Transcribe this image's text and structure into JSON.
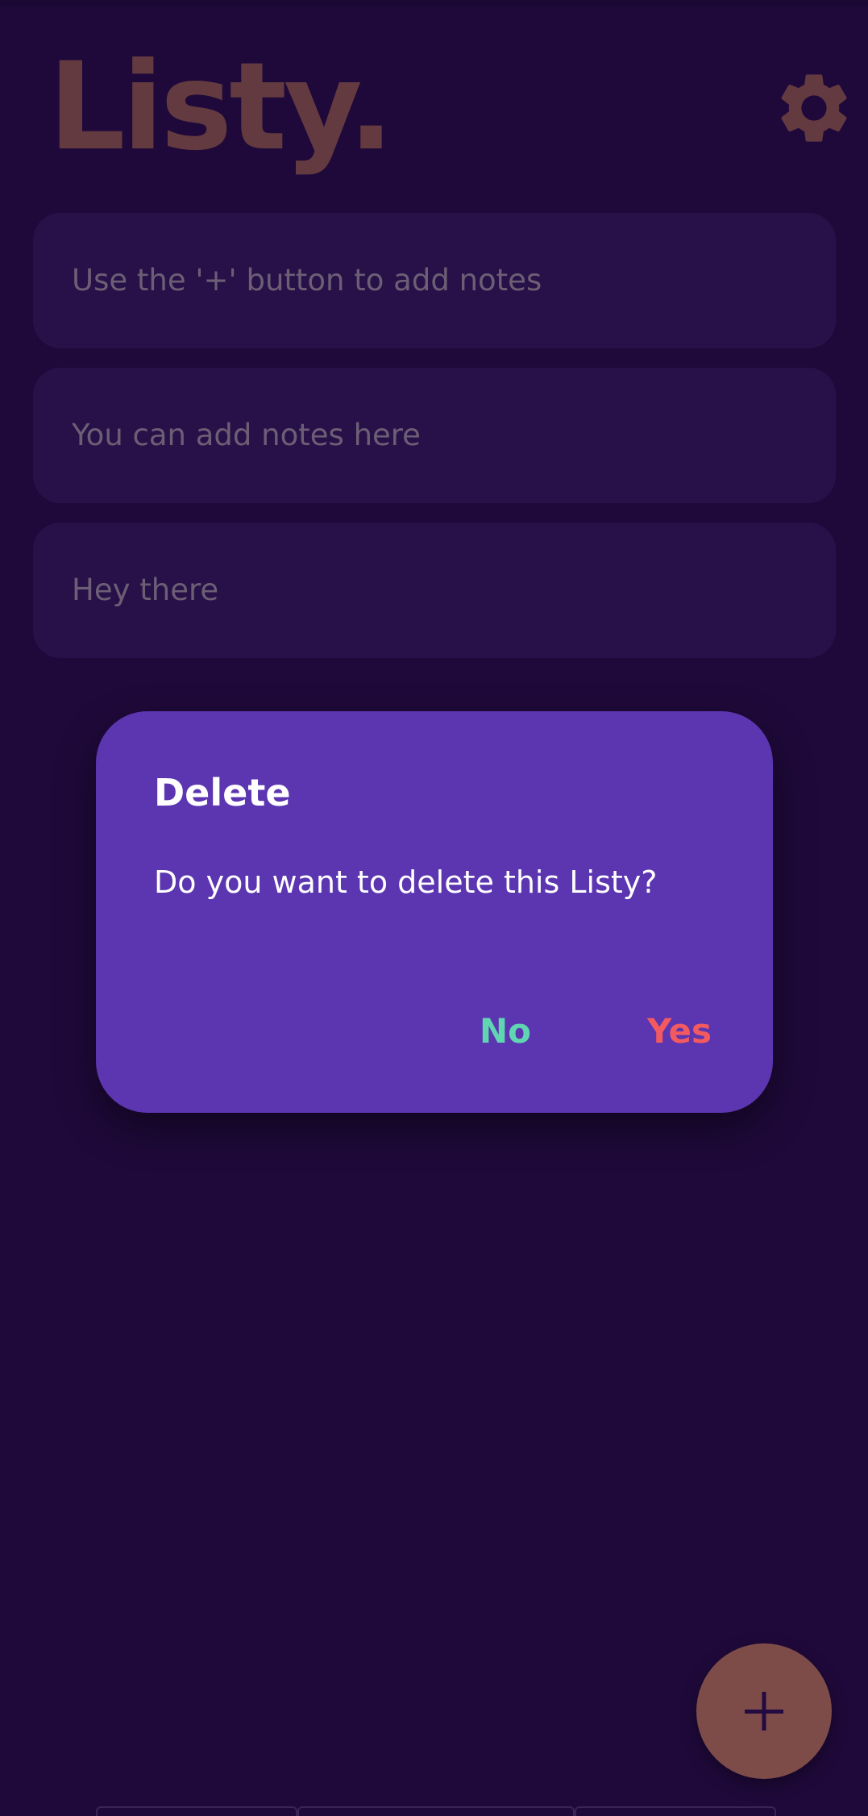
{
  "app": {
    "title": "Listy."
  },
  "header": {
    "settings_icon": "gear-icon"
  },
  "notes": [
    {
      "text": "Use the '+' button to add notes"
    },
    {
      "text": "You can add notes here"
    },
    {
      "text": "Hey there"
    }
  ],
  "dialog": {
    "title": "Delete",
    "message": "Do you want to delete this Listy?",
    "no_label": "No",
    "yes_label": "Yes"
  },
  "fab": {
    "icon": "plus-icon"
  },
  "colors": {
    "background": "#230b41",
    "accent": "#7e4d47",
    "dialog": "#5c35b1",
    "no": "#5fd6b1",
    "yes": "#f35a5f"
  }
}
